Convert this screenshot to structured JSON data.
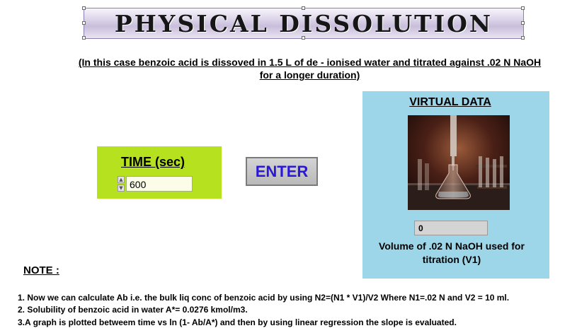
{
  "title": "PHYSICAL DISSOLUTION",
  "subtitle": "(In this case benzoic acid is dissoved in 1.5 L of de - ionised water and titrated against .02 N NaOH for a longer duration)",
  "time_panel": {
    "label": "TIME (sec)",
    "value": "600",
    "increment_icon": "triangle-up",
    "decrement_icon": "triangle-down"
  },
  "enter_button": {
    "label": "ENTER"
  },
  "virtual_data": {
    "title": "VIRTUAL DATA",
    "image": "titration-flask-photo",
    "v1_value": "0",
    "v1_label": "Volume of .02 N NaOH used for titration (V1)"
  },
  "note": {
    "heading": "NOTE :",
    "items": [
      "1. Now we can calculate Ab i.e. the bulk liq conc of benzoic acid by using  N2=(N1 * V1)/V2 Where N1=.02 N and V2 = 10 ml.",
      "2. Solubility of benzoic acid in water A*= 0.0276 kmol/m3.",
      "3.A graph is plotted betweem time vs ln (1- Ab/A*) and then by using linear regression  the slope is evaluated."
    ]
  },
  "colors": {
    "time_panel": "#b5e11f",
    "virtual_panel": "#9dd6e9",
    "enter_text": "#2a18d6",
    "banner": "#c9bedb"
  }
}
